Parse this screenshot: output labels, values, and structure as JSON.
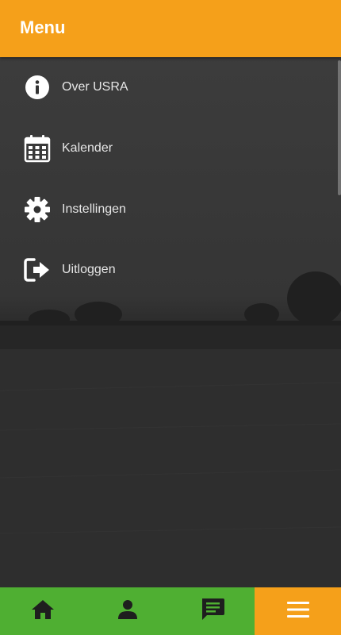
{
  "header": {
    "title": "Menu"
  },
  "menu": {
    "items": [
      {
        "label": "Over USRA",
        "icon": "info-icon"
      },
      {
        "label": "Kalender",
        "icon": "calendar-icon"
      },
      {
        "label": "Instellingen",
        "icon": "gear-icon"
      },
      {
        "label": "Uitloggen",
        "icon": "logout-icon"
      }
    ]
  },
  "bottom_nav": {
    "items": [
      {
        "icon": "home-icon"
      },
      {
        "icon": "user-icon"
      },
      {
        "icon": "chat-icon"
      },
      {
        "icon": "hamburger-menu-icon",
        "active": true
      }
    ]
  },
  "colors": {
    "header": "#f5a01a",
    "nav": "#4faf32",
    "nav_active": "#f5a01a"
  }
}
